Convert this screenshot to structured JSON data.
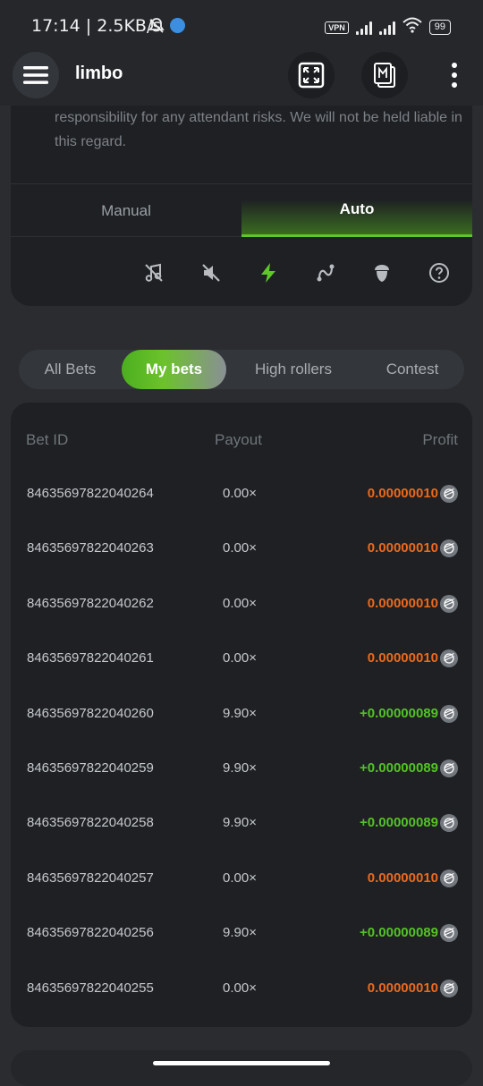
{
  "status": {
    "time": "17:14 | 2.5KB/s",
    "vpn": "VPN",
    "battery": "99"
  },
  "header": {
    "title": "limbo",
    "icons": [
      "menu-icon",
      "fullscreen-icon",
      "cards-icon",
      "more-icon"
    ]
  },
  "disclaimer": "responsibility for any attendant risks. We will not be held liable in this regard.",
  "mode_tabs": {
    "manual": "Manual",
    "auto": "Auto",
    "active": "Auto"
  },
  "toolbar_icons": [
    "music-off-icon",
    "sound-off-icon",
    "lightning-icon",
    "curve-icon",
    "acorn-icon",
    "help-icon"
  ],
  "bet_tabs": {
    "all": "All Bets",
    "mine": "My bets",
    "high": "High rollers",
    "contest": "Contest",
    "active": "My bets"
  },
  "table": {
    "headers": {
      "id": "Bet ID",
      "payout": "Payout",
      "profit": "Profit"
    },
    "rows": [
      {
        "id": "84635697822040264",
        "payout": "0.00×",
        "profit": "0.00000010",
        "positive": false
      },
      {
        "id": "84635697822040263",
        "payout": "0.00×",
        "profit": "0.00000010",
        "positive": false
      },
      {
        "id": "84635697822040262",
        "payout": "0.00×",
        "profit": "0.00000010",
        "positive": false
      },
      {
        "id": "84635697822040261",
        "payout": "0.00×",
        "profit": "0.00000010",
        "positive": false
      },
      {
        "id": "84635697822040260",
        "payout": "9.90×",
        "profit": "+0.00000089",
        "positive": true
      },
      {
        "id": "84635697822040259",
        "payout": "9.90×",
        "profit": "+0.00000089",
        "positive": true
      },
      {
        "id": "84635697822040258",
        "payout": "9.90×",
        "profit": "+0.00000089",
        "positive": true
      },
      {
        "id": "84635697822040257",
        "payout": "0.00×",
        "profit": "0.00000010",
        "positive": false
      },
      {
        "id": "84635697822040256",
        "payout": "9.90×",
        "profit": "+0.00000089",
        "positive": true
      },
      {
        "id": "84635697822040255",
        "payout": "0.00×",
        "profit": "0.00000010",
        "positive": false
      }
    ]
  },
  "colors": {
    "accent_green": "#5ec82a",
    "loss_orange": "#ea6a1d",
    "win_green": "#55c226",
    "background": "#2a2c30",
    "card": "#1e2023"
  }
}
